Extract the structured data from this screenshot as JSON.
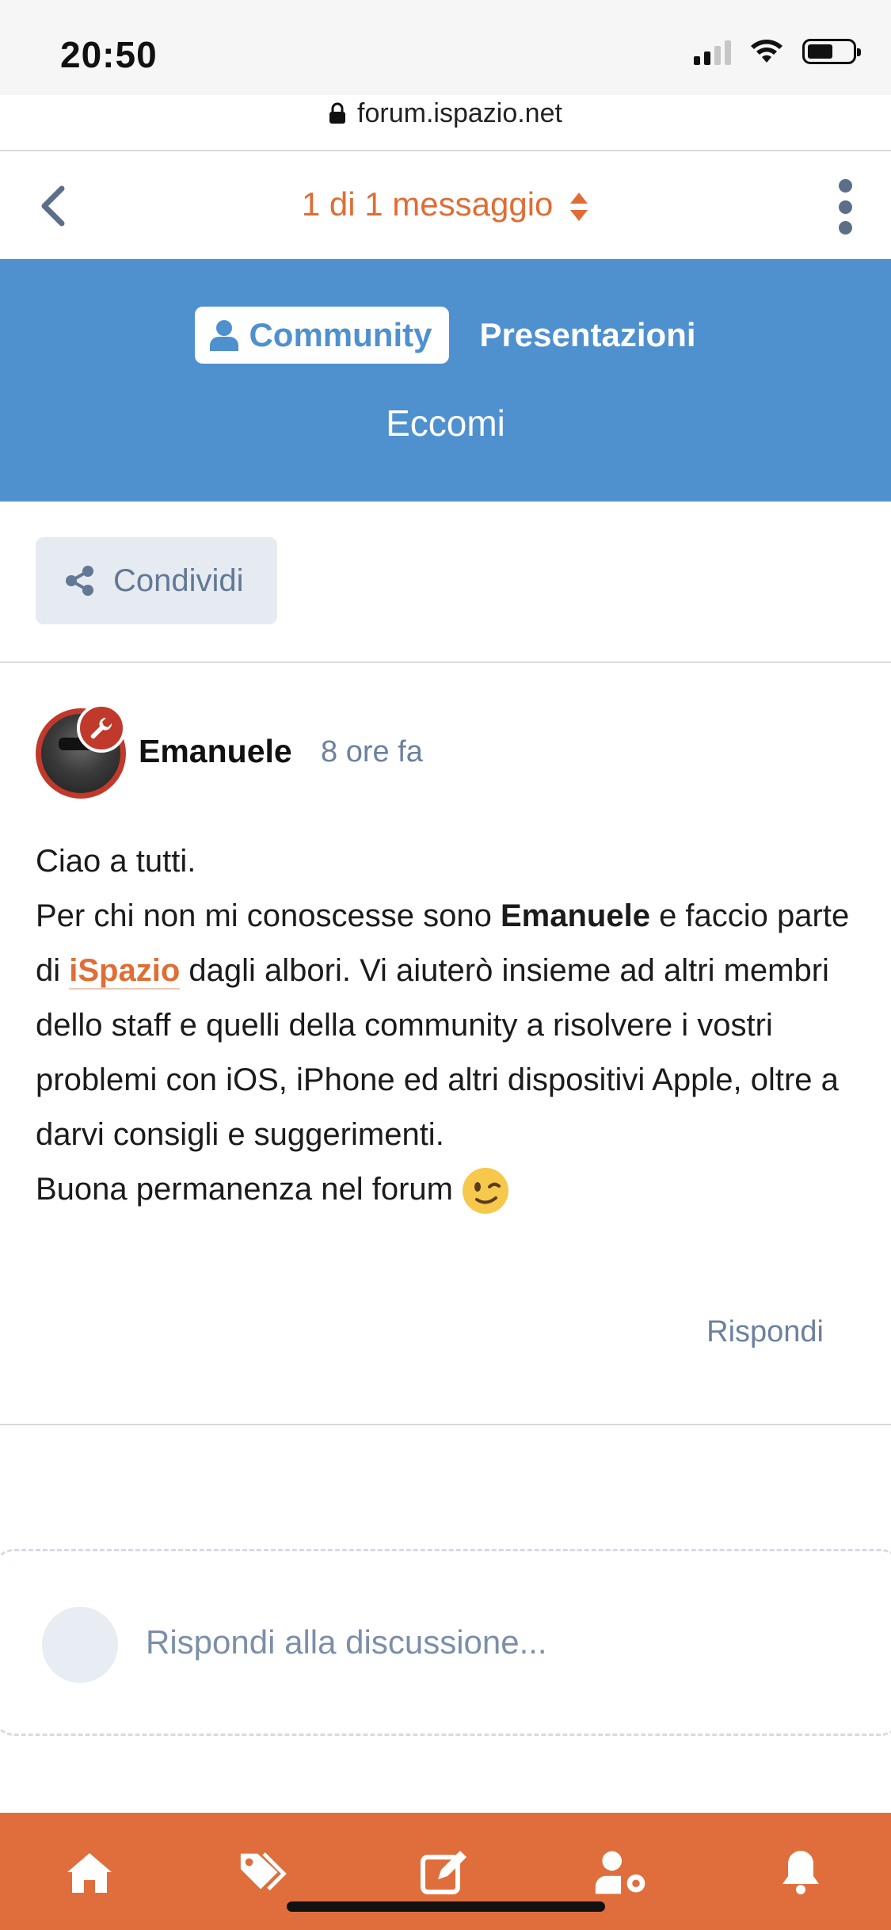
{
  "status_bar": {
    "time": "20:50"
  },
  "browser": {
    "url": "forum.ispazio.net"
  },
  "thread_nav": {
    "title": "1 di 1 messaggio"
  },
  "header": {
    "breadcrumb_1": "Community",
    "breadcrumb_2": "Presentazioni",
    "thread_title": "Eccomi"
  },
  "actions": {
    "share_label": "Condividi"
  },
  "post": {
    "author": "Emanuele",
    "time_ago": "8 ore fa",
    "line1": "Ciao a tutti.",
    "line2_a": "Per chi non mi conoscesse sono ",
    "line2_bold": "Emanuele",
    "line2_b": " e faccio parte di ",
    "line2_link": "iSpazio",
    "line2_c": " dagli albori. Vi aiuterò insieme ad altri membri dello staff e quelli della community a risolvere i vostri problemi con iOS, iPhone ed altri dispositivi Apple, oltre a darvi consigli e suggerimenti.",
    "line3": "Buona permanenza nel forum",
    "reply_label": "Rispondi"
  },
  "reply_box": {
    "placeholder": "Rispondi alla discussione..."
  },
  "bottom_tabs": [
    "home-icon",
    "tags-icon",
    "compose-icon",
    "user-settings-icon",
    "bell-icon"
  ],
  "colors": {
    "accent": "#e06d35",
    "header_blue": "#4f90cf",
    "bottom_bar": "#df6e3c",
    "muted": "#6c819e"
  }
}
